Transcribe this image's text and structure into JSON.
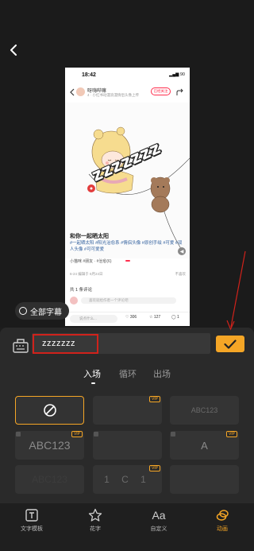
{
  "preview": {
    "status_time": "18:42",
    "battery": "90",
    "author_name": "呀嗨哔嘛",
    "author_sub": "4 · 小红书动漫浪漫情侣头像上传",
    "follow_label": "已经关注",
    "caption_overlay": "zzzzzzz",
    "post_title": "和你一起晒太阳",
    "post_tags": "#一起晒太阳 #阳光治愈系 #情侣头像 #原创手绘 #可爱 #双人头像 #可可爱爱",
    "post_meta": "小猫咪  #朋友 · #治愈(6)",
    "post_date": "6-24 编辑于 6月24日",
    "post_report": "不喜欢",
    "comments_count": "共 1 条评论",
    "comment_placeholder": "喜欢就给作者一个评论吧",
    "say_something": "说点什么...",
    "likes": "306",
    "collects": "127",
    "comments": "1"
  },
  "all_subtitles_label": "全部字幕",
  "editor": {
    "text_value": "zzzzzzz",
    "confirm_icon": "check-icon",
    "tabs": [
      "入场",
      "循环",
      "出场"
    ],
    "active_tab": "入场",
    "grid": [
      {
        "label": "",
        "icon": "none-icon",
        "vip": "",
        "selected": true
      },
      {
        "label": "",
        "icon": "",
        "vip": "VIP",
        "selected": false
      },
      {
        "label": "ABC123",
        "icon": "",
        "vip": "",
        "selected": false
      },
      {
        "label": "ABC123",
        "icon": "",
        "vip": "VIP",
        "selected": false
      },
      {
        "label": "",
        "icon": "",
        "vip": "",
        "selected": false
      },
      {
        "label": "A",
        "icon": "",
        "vip": "VIP",
        "selected": false
      },
      {
        "label": "ABC123",
        "icon": "",
        "vip": "",
        "selected": false
      },
      {
        "label": "1 C 1",
        "icon": "",
        "vip": "VIP",
        "selected": false
      },
      {
        "label": "",
        "icon": "",
        "vip": "",
        "selected": false
      }
    ]
  },
  "nav": [
    {
      "label": "文字模板",
      "icon": "text-template-icon"
    },
    {
      "label": "花字",
      "icon": "star-icon"
    },
    {
      "label": "自定义",
      "icon": "font-aa-icon"
    },
    {
      "label": "动画",
      "icon": "animation-icon"
    }
  ],
  "nav_active": "动画",
  "colors": {
    "accent": "#f5a626",
    "highlight_red": "#d0221b",
    "panel": "#2a2a2a"
  }
}
